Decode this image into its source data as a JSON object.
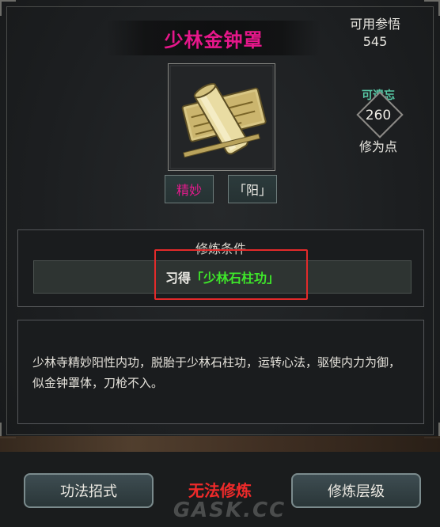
{
  "header": {
    "title": "少林金钟罩",
    "available_label": "可用参悟",
    "available_value": "545"
  },
  "item": {
    "icon": "scroll-icon"
  },
  "forget": {
    "label": "可遗忘",
    "value": "260",
    "unit": "修为点"
  },
  "tags": [
    {
      "label": "精妙",
      "color": "#e61a8e"
    },
    {
      "label": "「阳」",
      "color": "#ecebe5"
    }
  ],
  "condition": {
    "title": "修炼条件",
    "prefix": "习得",
    "skill": "「少林石柱功」",
    "skill_color": "#3ee62a"
  },
  "description": "少林寺精妙阳性内功，脱胎于少林石柱功，运转心法，驱使内力为御，似金钟罩体，刀枪不入。",
  "footer": {
    "left_button": "功法招式",
    "status": "无法修炼",
    "right_button": "修炼层级",
    "watermark": "GASK.CC"
  }
}
